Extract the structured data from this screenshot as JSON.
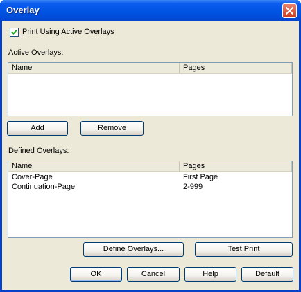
{
  "window": {
    "title": "Overlay"
  },
  "checkbox": {
    "label": "Print Using Active Overlays",
    "checked": true
  },
  "active_overlays": {
    "label": "Active Overlays:",
    "columns": [
      "Name",
      "Pages"
    ],
    "rows": []
  },
  "buttons": {
    "add": "Add",
    "remove": "Remove",
    "define": "Define Overlays...",
    "test_print": "Test Print",
    "ok": "OK",
    "cancel": "Cancel",
    "help": "Help",
    "default": "Default"
  },
  "defined_overlays": {
    "label": "Defined Overlays:",
    "columns": [
      "Name",
      "Pages"
    ],
    "rows": [
      {
        "name": "Cover-Page",
        "pages": "First Page"
      },
      {
        "name": "Continuation-Page",
        "pages": "2-999"
      }
    ]
  }
}
